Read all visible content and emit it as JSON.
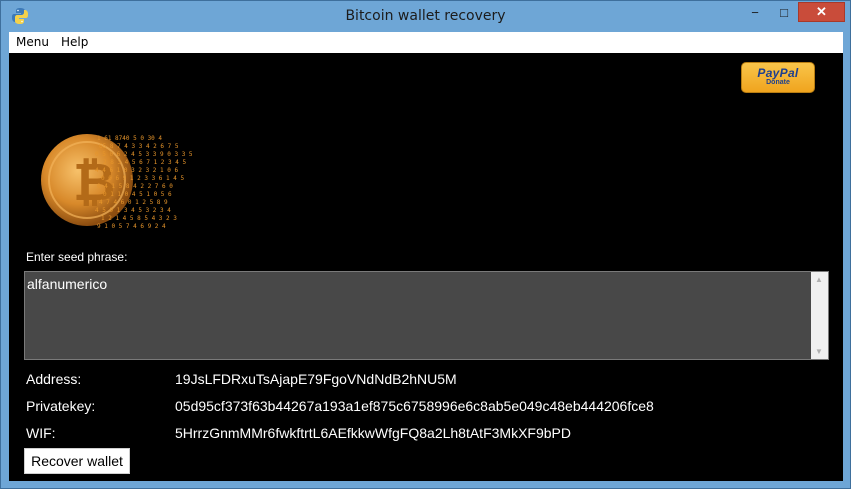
{
  "window": {
    "title": "Bitcoin wallet recovery",
    "icon": "python-icon",
    "controls": {
      "minimize": "−",
      "maximize": "□",
      "close": "✕"
    }
  },
  "menubar": {
    "items": [
      "Menu",
      "Help"
    ]
  },
  "donate": {
    "brand": "PayPal",
    "label": "Donate"
  },
  "seed": {
    "label": "Enter seed phrase:",
    "value": "alfanumerico",
    "scroll_up": "▲",
    "scroll_down": "▼"
  },
  "fields": [
    {
      "label": "Address:",
      "value": "19JsLFDRxuTsAjapE79FgoVNdNdB2hNU5M"
    },
    {
      "label": "Privatekey:",
      "value": "05d95cf373f63b44267a193a1ef875c6758996e6c8ab5e049c48eb444206fce8"
    },
    {
      "label": "WIF:",
      "value": "5HrrzGnmMMr6fwkftrtL6AEfkkwWfgFQ8a2Lh8tAtF3MkXF9bPD"
    }
  ],
  "actions": {
    "recover_label": "Recover wallet"
  },
  "colors": {
    "accent": "#f0a41e",
    "background": "#000000",
    "titlebar": "#6ea6d6"
  }
}
